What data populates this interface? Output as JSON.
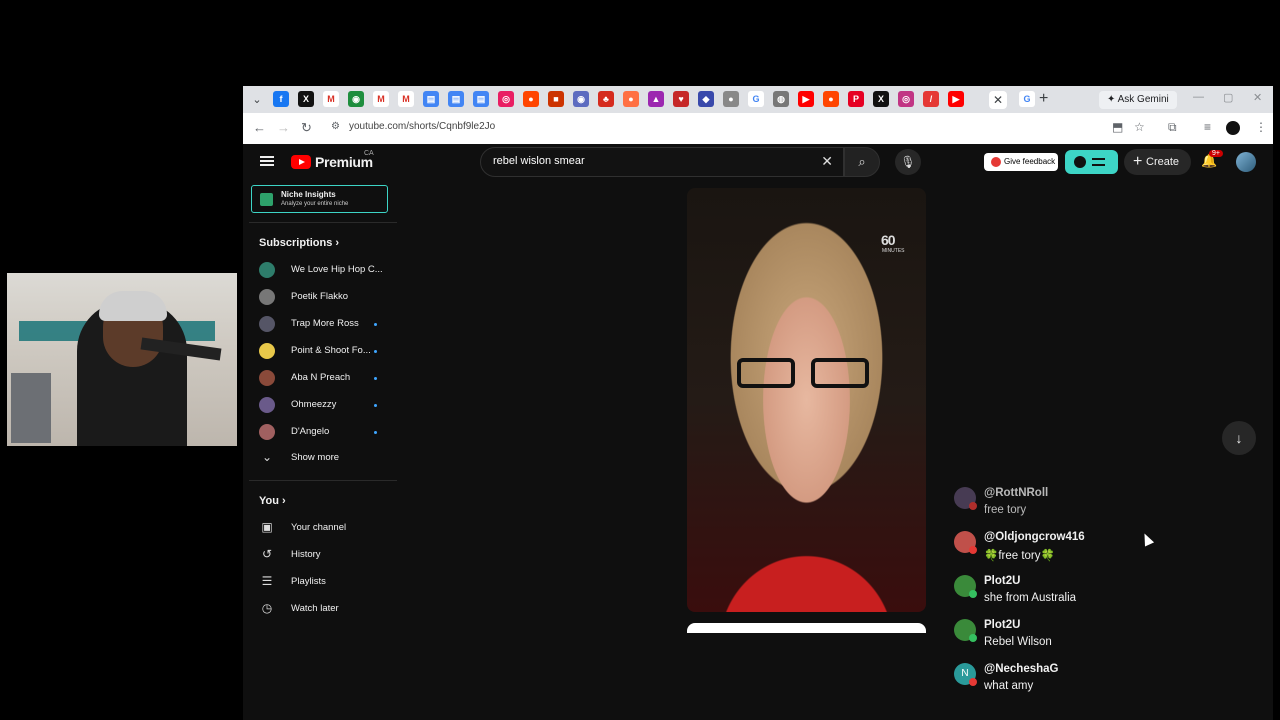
{
  "browser": {
    "url": "youtube.com/shorts/Cqnbf9le2Jo",
    "ask_gemini": "Ask Gemini",
    "tab_close": "✕",
    "new_tab": "+"
  },
  "youtube": {
    "logo_text": "Premium",
    "region": "CA",
    "search_query": "rebel wislon smear",
    "feedback_label": "Give feedback",
    "create_label": "Create",
    "notification_badge": "9+"
  },
  "sidebar": {
    "niche": {
      "title": "Niche Insights",
      "subtitle": "Analyze your entire niche"
    },
    "subscriptions_title": "Subscriptions",
    "subscriptions": [
      {
        "name": "We Love Hip Hop C...",
        "color": "#2e7d6b",
        "live": false
      },
      {
        "name": "Poetik Flakko",
        "color": "#777777",
        "live": false
      },
      {
        "name": "Trap More Ross",
        "color": "#555566",
        "live": true
      },
      {
        "name": "Point & Shoot Fo...",
        "color": "#e8c84a",
        "live": true
      },
      {
        "name": "Aba N Preach",
        "color": "#8a4a3a",
        "live": true
      },
      {
        "name": "Ohmeezzy",
        "color": "#6a5a8a",
        "live": true
      },
      {
        "name": "D'Angelo",
        "color": "#a06060",
        "live": true
      }
    ],
    "show_more": "Show more",
    "you_title": "You",
    "you_items": [
      {
        "label": "Your channel",
        "icon": "person-icon"
      },
      {
        "label": "History",
        "icon": "history-icon"
      },
      {
        "label": "Playlists",
        "icon": "playlist-icon"
      },
      {
        "label": "Watch later",
        "icon": "clock-icon"
      }
    ]
  },
  "video": {
    "watermark": "60",
    "watermark_sub": "MINUTES"
  },
  "comments": [
    {
      "user": "@RottNRoll",
      "message": "free tory",
      "avatar_color": "#5a4a6a",
      "badge": "red",
      "dim": true
    },
    {
      "user": "@Oldjongcrow416",
      "message": "🍀free tory🍀",
      "avatar_color": "#c0504a",
      "badge": "red",
      "dim": false
    },
    {
      "user": "Plot2U",
      "message": "she from Australia",
      "avatar_color": "#3a8a3a",
      "badge": "green",
      "dim": false
    },
    {
      "user": "Plot2U",
      "message": "Rebel Wilson",
      "avatar_color": "#3a8a3a",
      "badge": "green",
      "dim": false
    },
    {
      "user": "@NecheshaG",
      "message": "what amy",
      "avatar_color": "#2a9a9a",
      "badge": "red",
      "dim": false,
      "initial": "N"
    }
  ]
}
